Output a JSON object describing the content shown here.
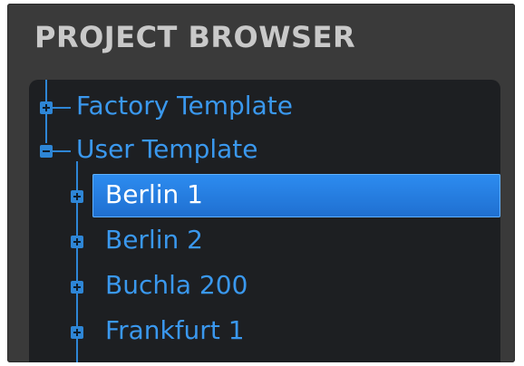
{
  "panel": {
    "title": "PROJECT BROWSER"
  },
  "tree": {
    "items": [
      {
        "label": "Factory Template",
        "expander": "plus"
      },
      {
        "label": "User Template",
        "expander": "minus"
      },
      {
        "label": "Berlin 1",
        "expander": "plus",
        "selected": true
      },
      {
        "label": "Berlin 2",
        "expander": "plus"
      },
      {
        "label": "Buchla 200",
        "expander": "plus"
      },
      {
        "label": "Frankfurt 1",
        "expander": "plus"
      }
    ]
  },
  "colors": {
    "accent": "#2e86d6",
    "selection": "#2d8cf0",
    "panel_bg": "#3a3a3a",
    "tree_bg": "#1d1f22"
  }
}
